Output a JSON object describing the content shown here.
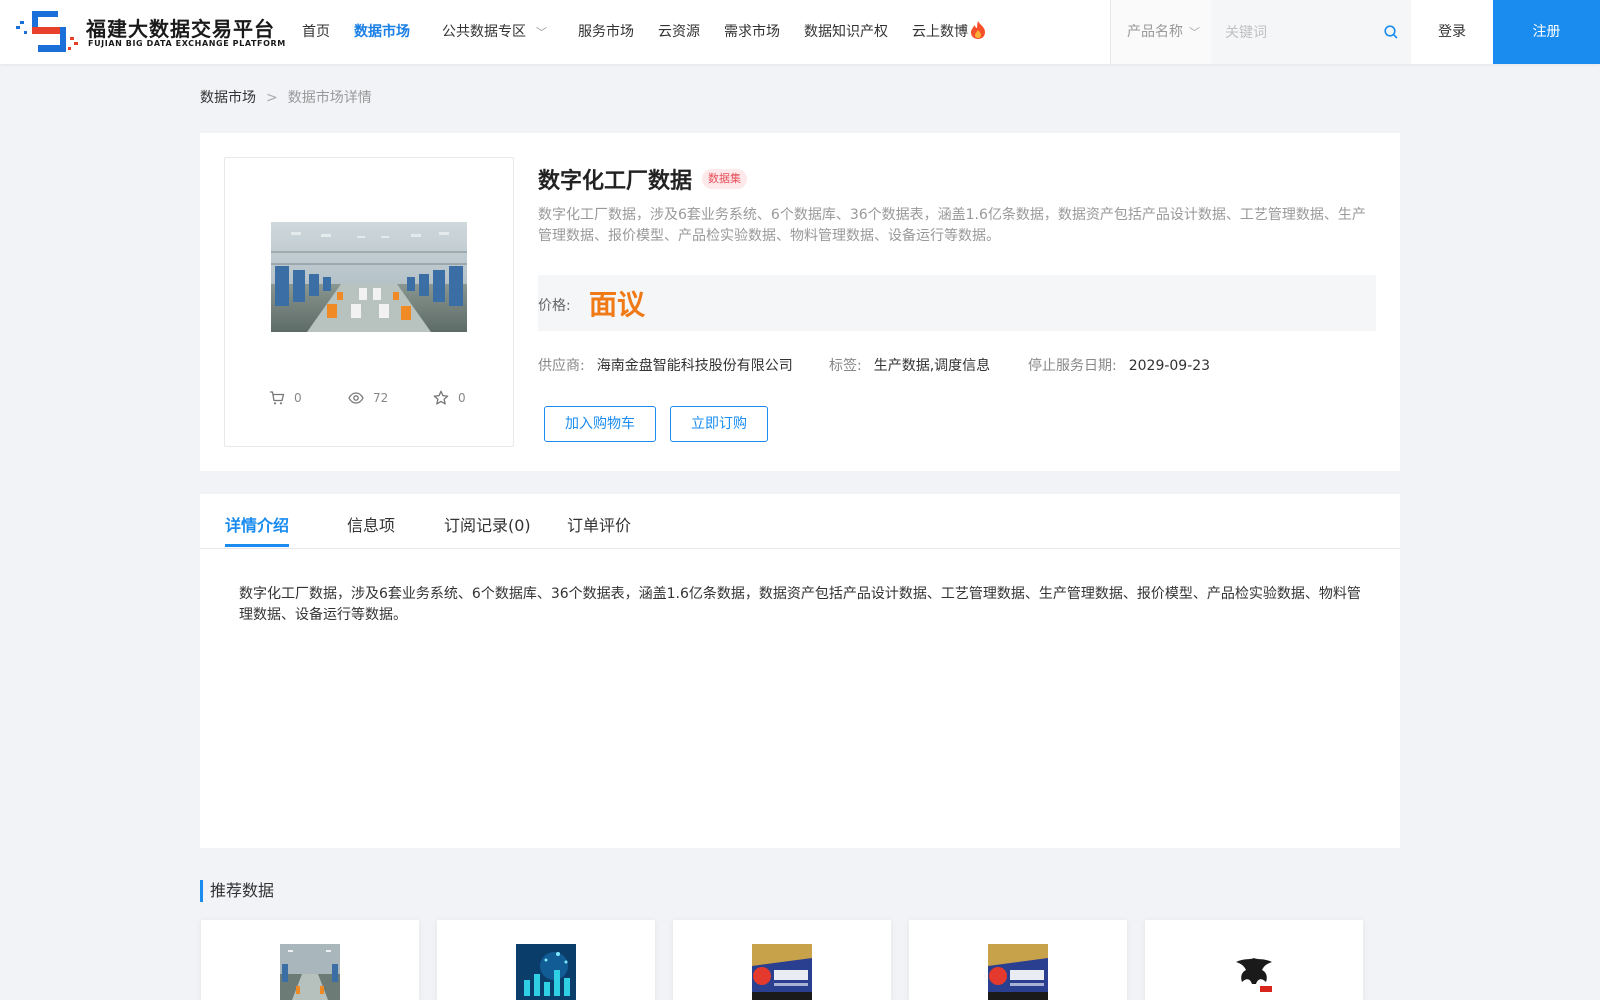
{
  "header": {
    "logo_title": "福建大数据交易平台",
    "logo_subtitle": "FUJIAN BIG DATA EXCHANGE  PLATFORM",
    "nav": [
      {
        "label": "首页"
      },
      {
        "label": "数据市场",
        "active": true
      },
      {
        "label": "公共数据专区",
        "has_dropdown": true
      },
      {
        "label": "服务市场"
      },
      {
        "label": "云资源"
      },
      {
        "label": "需求市场"
      },
      {
        "label": "数据知识产权"
      },
      {
        "label": "云上数博",
        "icon": "fire-icon"
      }
    ],
    "search": {
      "category": "产品名称",
      "placeholder": "关键词",
      "value": ""
    },
    "login_label": "登录",
    "register_label": "注册",
    "accent_color": "#1a8cf0"
  },
  "breadcrumb": {
    "parent": "数据市场",
    "separator": ">",
    "current": "数据市场详情"
  },
  "product": {
    "title": "数字化工厂数据",
    "badge": "数据集",
    "description": "数字化工厂数据，涉及6套业务系统、6个数据库、36个数据表，涵盖1.6亿条数据，数据资产包括产品设计数据、工艺管理数据、生产管理数据、报价模型、产品检实验数据、物料管理数据、设备运行等数据。",
    "price_label": "价格:",
    "price_value": "面议",
    "price_color": "#f07b16",
    "stats": {
      "cart_count": "0",
      "view_count": "72",
      "favorite_count": "0"
    },
    "supplier_label": "供应商:",
    "supplier": "海南金盘智能科技股份有限公司",
    "tags_label": "标签:",
    "tags": "生产数据,调度信息",
    "end_date_label": "停止服务日期:",
    "end_date": "2029-09-23",
    "add_cart_label": "加入购物车",
    "subscribe_label": "立即订购"
  },
  "detail": {
    "tabs": [
      {
        "label": "详情介绍",
        "active": true
      },
      {
        "label": "信息项"
      },
      {
        "label": "订阅记录(0)"
      },
      {
        "label": "订单评价"
      }
    ],
    "content": "数字化工厂数据，涉及6套业务系统、6个数据库、36个数据表，涵盖1.6亿条数据，数据资产包括产品设计数据、工艺管理数据、生产管理数据、报价模型、产品检实验数据、物料管理数据、设备运行等数据。"
  },
  "recommend": {
    "title": "推荐数据",
    "items": [
      {
        "thumb": "factory-image"
      },
      {
        "thumb": "digital-tech-image"
      },
      {
        "thumb": "jinpan-logo-image"
      },
      {
        "thumb": "jinpan-logo-image"
      },
      {
        "thumb": "eagle-logo-image"
      }
    ]
  }
}
